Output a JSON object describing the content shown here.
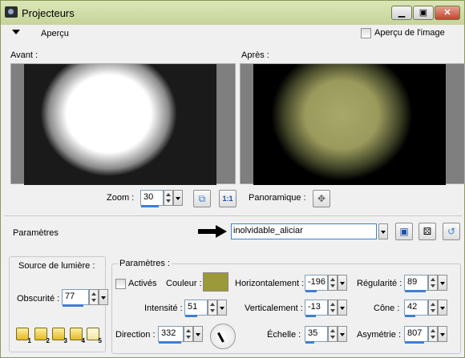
{
  "window": {
    "title": "Projecteurs",
    "minimize_icon": "minimize-icon",
    "maximize_icon": "maximize-icon",
    "close_icon": "close-icon"
  },
  "menu": {
    "apercu_label": "Aperçu",
    "apercu_image_label": "Aperçu de l'image",
    "apercu_image_checked": false
  },
  "preview": {
    "avant_label": "Avant :",
    "apres_label": "Après :"
  },
  "zoom": {
    "label": "Zoom :",
    "value": "30",
    "panoramique_label": "Panoramique :"
  },
  "parametres": {
    "label": "Paramètres",
    "preset_value": "inolvidable_aliciar"
  },
  "source": {
    "title": "Source de lumière :",
    "obscurite_label": "Obscurité :",
    "obscurite_value": "77",
    "presets": [
      "1",
      "2",
      "3",
      "4",
      "5"
    ]
  },
  "params": {
    "title": "Paramètres :",
    "activer_label": "Activés",
    "activer_checked": false,
    "couleur_label": "Couleur :",
    "couleur_value": "#9b9a37",
    "horizontalement_label": "Horizontalement :",
    "horizontalement_value": "-196",
    "regularite_label": "Régularité :",
    "regularite_value": "89",
    "intensite_label": "Intensité :",
    "intensite_value": "51",
    "verticalement_label": "Verticalement :",
    "verticalement_value": "-13",
    "cone_label": "Cône :",
    "cone_value": "42",
    "direction_label": "Direction :",
    "direction_value": "332",
    "echelle_label": "Échelle :",
    "echelle_value": "35",
    "asymetrie_label": "Asymétrie :",
    "asymetrie_value": "807"
  },
  "colors": {
    "titlebar": "#c6d59a",
    "accent": "#3d7fd6"
  }
}
